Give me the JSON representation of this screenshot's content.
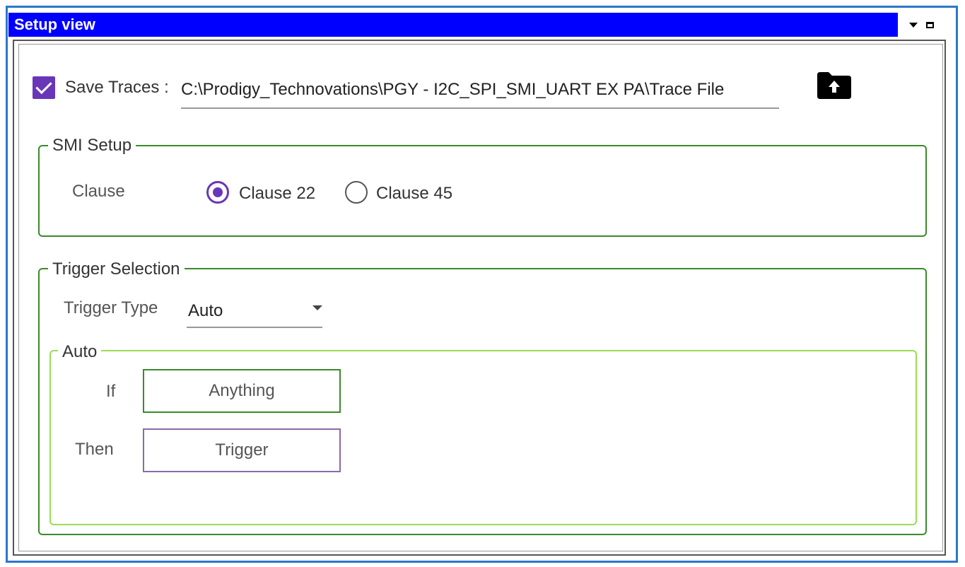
{
  "window": {
    "title": "Setup view"
  },
  "save_traces": {
    "checked": true,
    "label": "Save Traces :",
    "path": "C:\\Prodigy_Technovations\\PGY - I2C_SPI_SMI_UART EX PA\\Trace File",
    "browse_icon": "folder-upload-icon"
  },
  "smi_setup": {
    "legend": "SMI Setup",
    "clause_label": "Clause",
    "options": [
      {
        "label": "Clause 22",
        "selected": true
      },
      {
        "label": "Clause 45",
        "selected": false
      }
    ]
  },
  "trigger_selection": {
    "legend": "Trigger Selection",
    "trigger_type_label": "Trigger Type",
    "trigger_type_value": "Auto",
    "auto": {
      "legend": "Auto",
      "if_label": "If",
      "if_value": "Anything",
      "then_label": "Then",
      "then_value": "Trigger"
    }
  },
  "colors": {
    "title_bg": "#0000ff",
    "accent": "#6a36b8",
    "group_border": "#3a8a2a",
    "auto_border": "#99dd55"
  }
}
